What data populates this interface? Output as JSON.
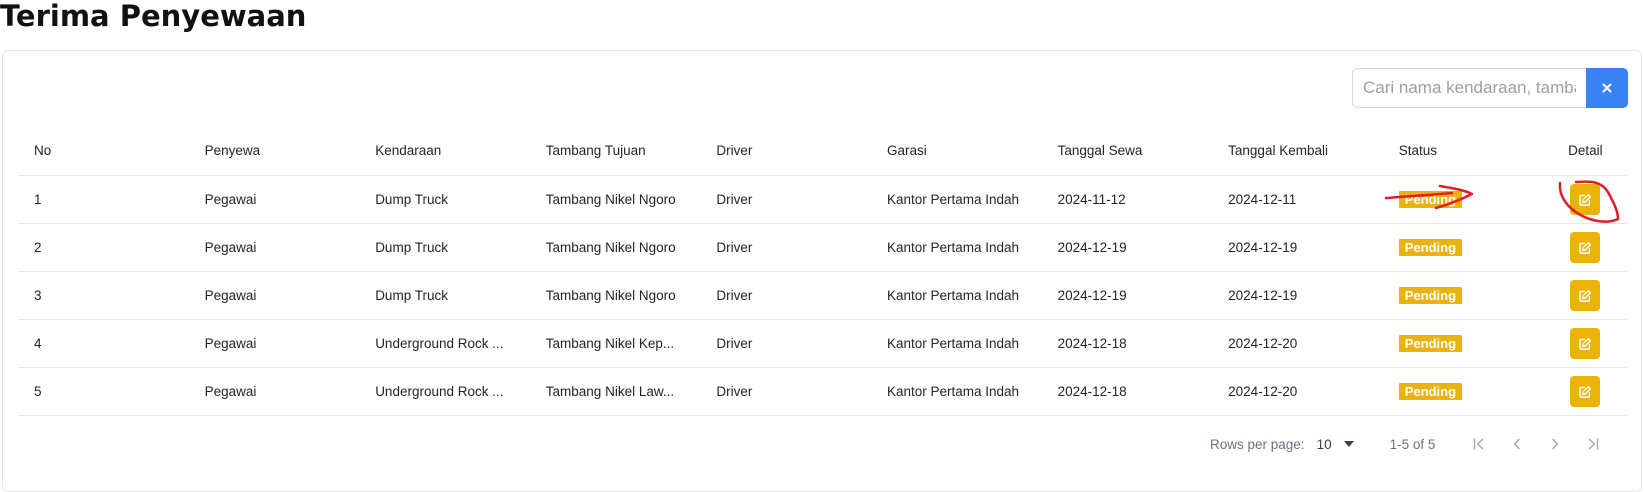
{
  "page": {
    "title": "Terima Penyewaan"
  },
  "search": {
    "placeholder": "Cari nama kendaraan, tambang, atau garasi",
    "clear_label": "×"
  },
  "table": {
    "columns": [
      "No",
      "Penyewa",
      "Kendaraan",
      "Tambang Tujuan",
      "Driver",
      "Garasi",
      "Tanggal Sewa",
      "Tanggal Kembali",
      "Status",
      "Detail"
    ],
    "rows": [
      [
        "1",
        "Pegawai",
        "Dump Truck",
        "Tambang Nikel Ngoro",
        "Driver",
        "Kantor Pertama Indah",
        "2024-11-12",
        "2024-12-11",
        "Pending"
      ],
      [
        "2",
        "Pegawai",
        "Dump Truck",
        "Tambang Nikel Ngoro",
        "Driver",
        "Kantor Pertama Indah",
        "2024-12-19",
        "2024-12-19",
        "Pending"
      ],
      [
        "3",
        "Pegawai",
        "Dump Truck",
        "Tambang Nikel Ngoro",
        "Driver",
        "Kantor Pertama Indah",
        "2024-12-19",
        "2024-12-19",
        "Pending"
      ],
      [
        "4",
        "Pegawai",
        "Underground Rock ...",
        "Tambang Nikel Kep...",
        "Driver",
        "Kantor Pertama Indah",
        "2024-12-18",
        "2024-12-20",
        "Pending"
      ],
      [
        "5",
        "Pegawai",
        "Underground Rock ...",
        "Tambang Nikel Law...",
        "Driver",
        "Kantor Pertama Indah",
        "2024-12-18",
        "2024-12-20",
        "Pending"
      ]
    ],
    "detail_icon": "edit-icon"
  },
  "pagination": {
    "rows_per_page_label": "Rows per page:",
    "rows_per_page": "10",
    "range": "1-5 of 5"
  },
  "colors": {
    "status_pending": "#eab308",
    "primary": "#3b82f6",
    "annotation": "#e11d2a"
  }
}
